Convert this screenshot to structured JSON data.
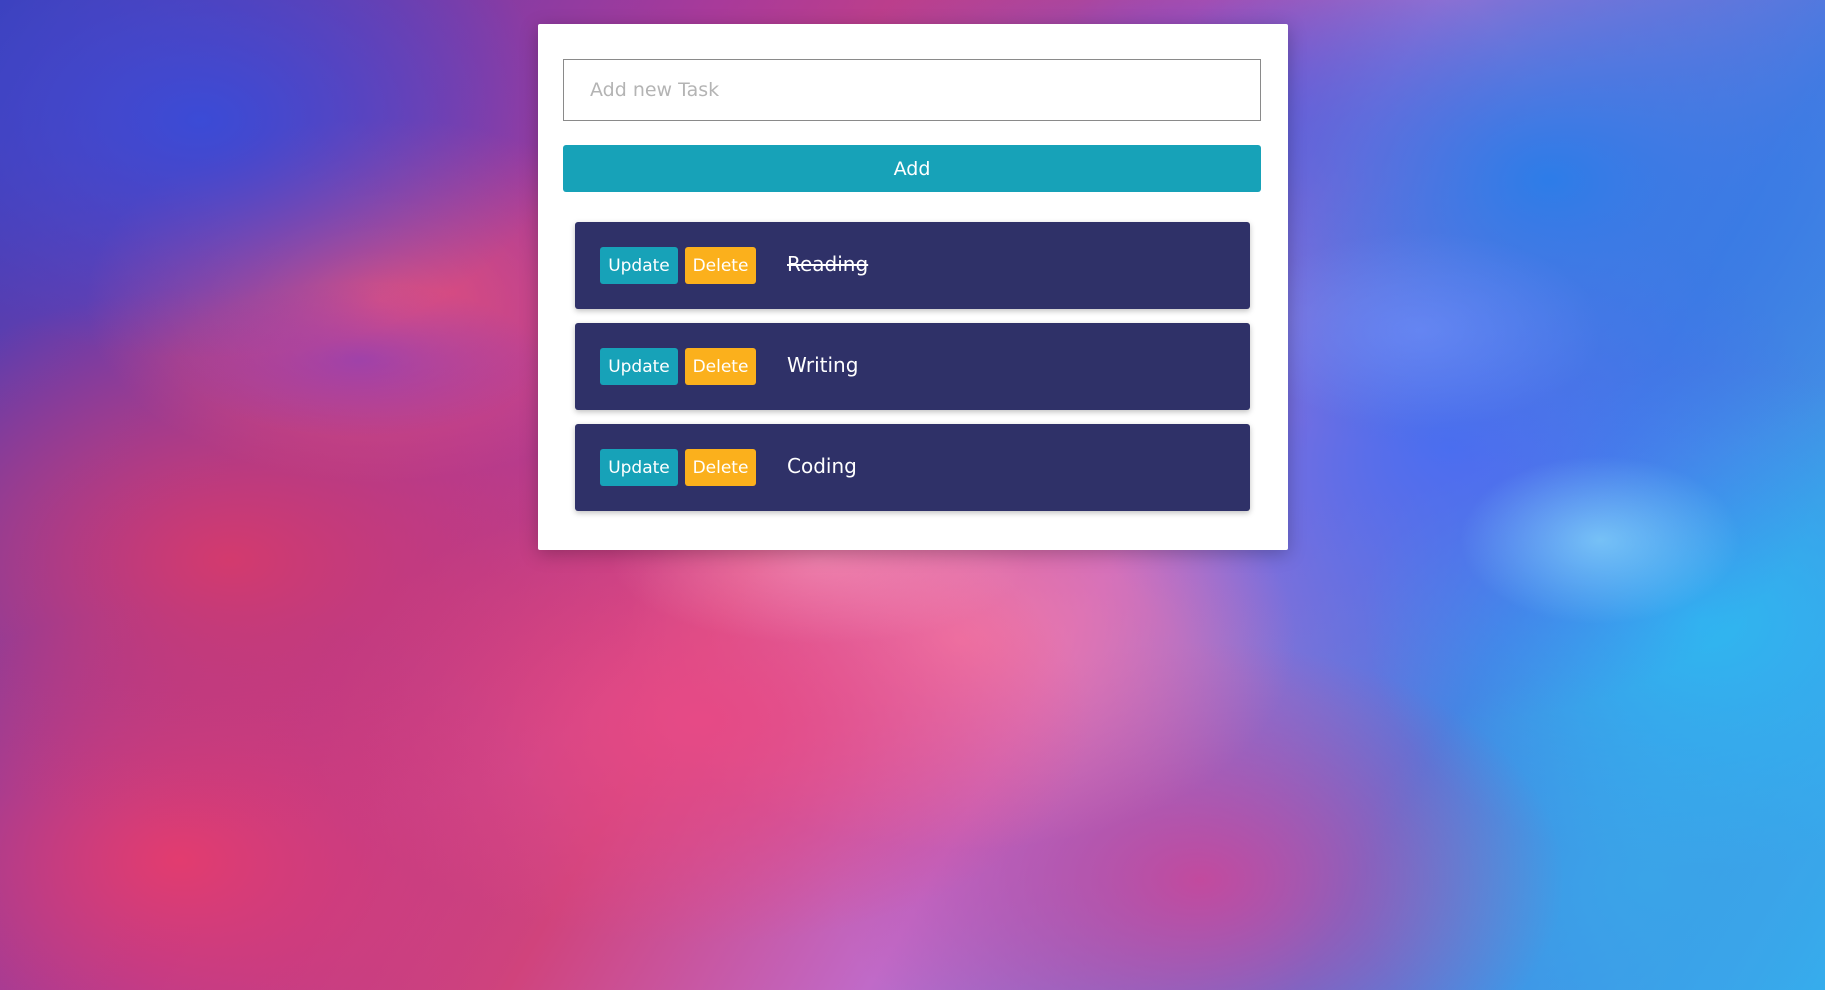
{
  "form": {
    "input_placeholder": "Add new Task",
    "input_value": "",
    "add_label": "Add"
  },
  "tasks": [
    {
      "text": "Reading",
      "completed": true,
      "update_label": "Update",
      "delete_label": "Delete"
    },
    {
      "text": "Writing",
      "completed": false,
      "update_label": "Update",
      "delete_label": "Delete"
    },
    {
      "text": "Coding",
      "completed": false,
      "update_label": "Update",
      "delete_label": "Delete"
    }
  ],
  "colors": {
    "primary": "#17a2b8",
    "warning": "#fbb01c",
    "task_background": "#2f3168",
    "card_background": "#ffffff"
  }
}
